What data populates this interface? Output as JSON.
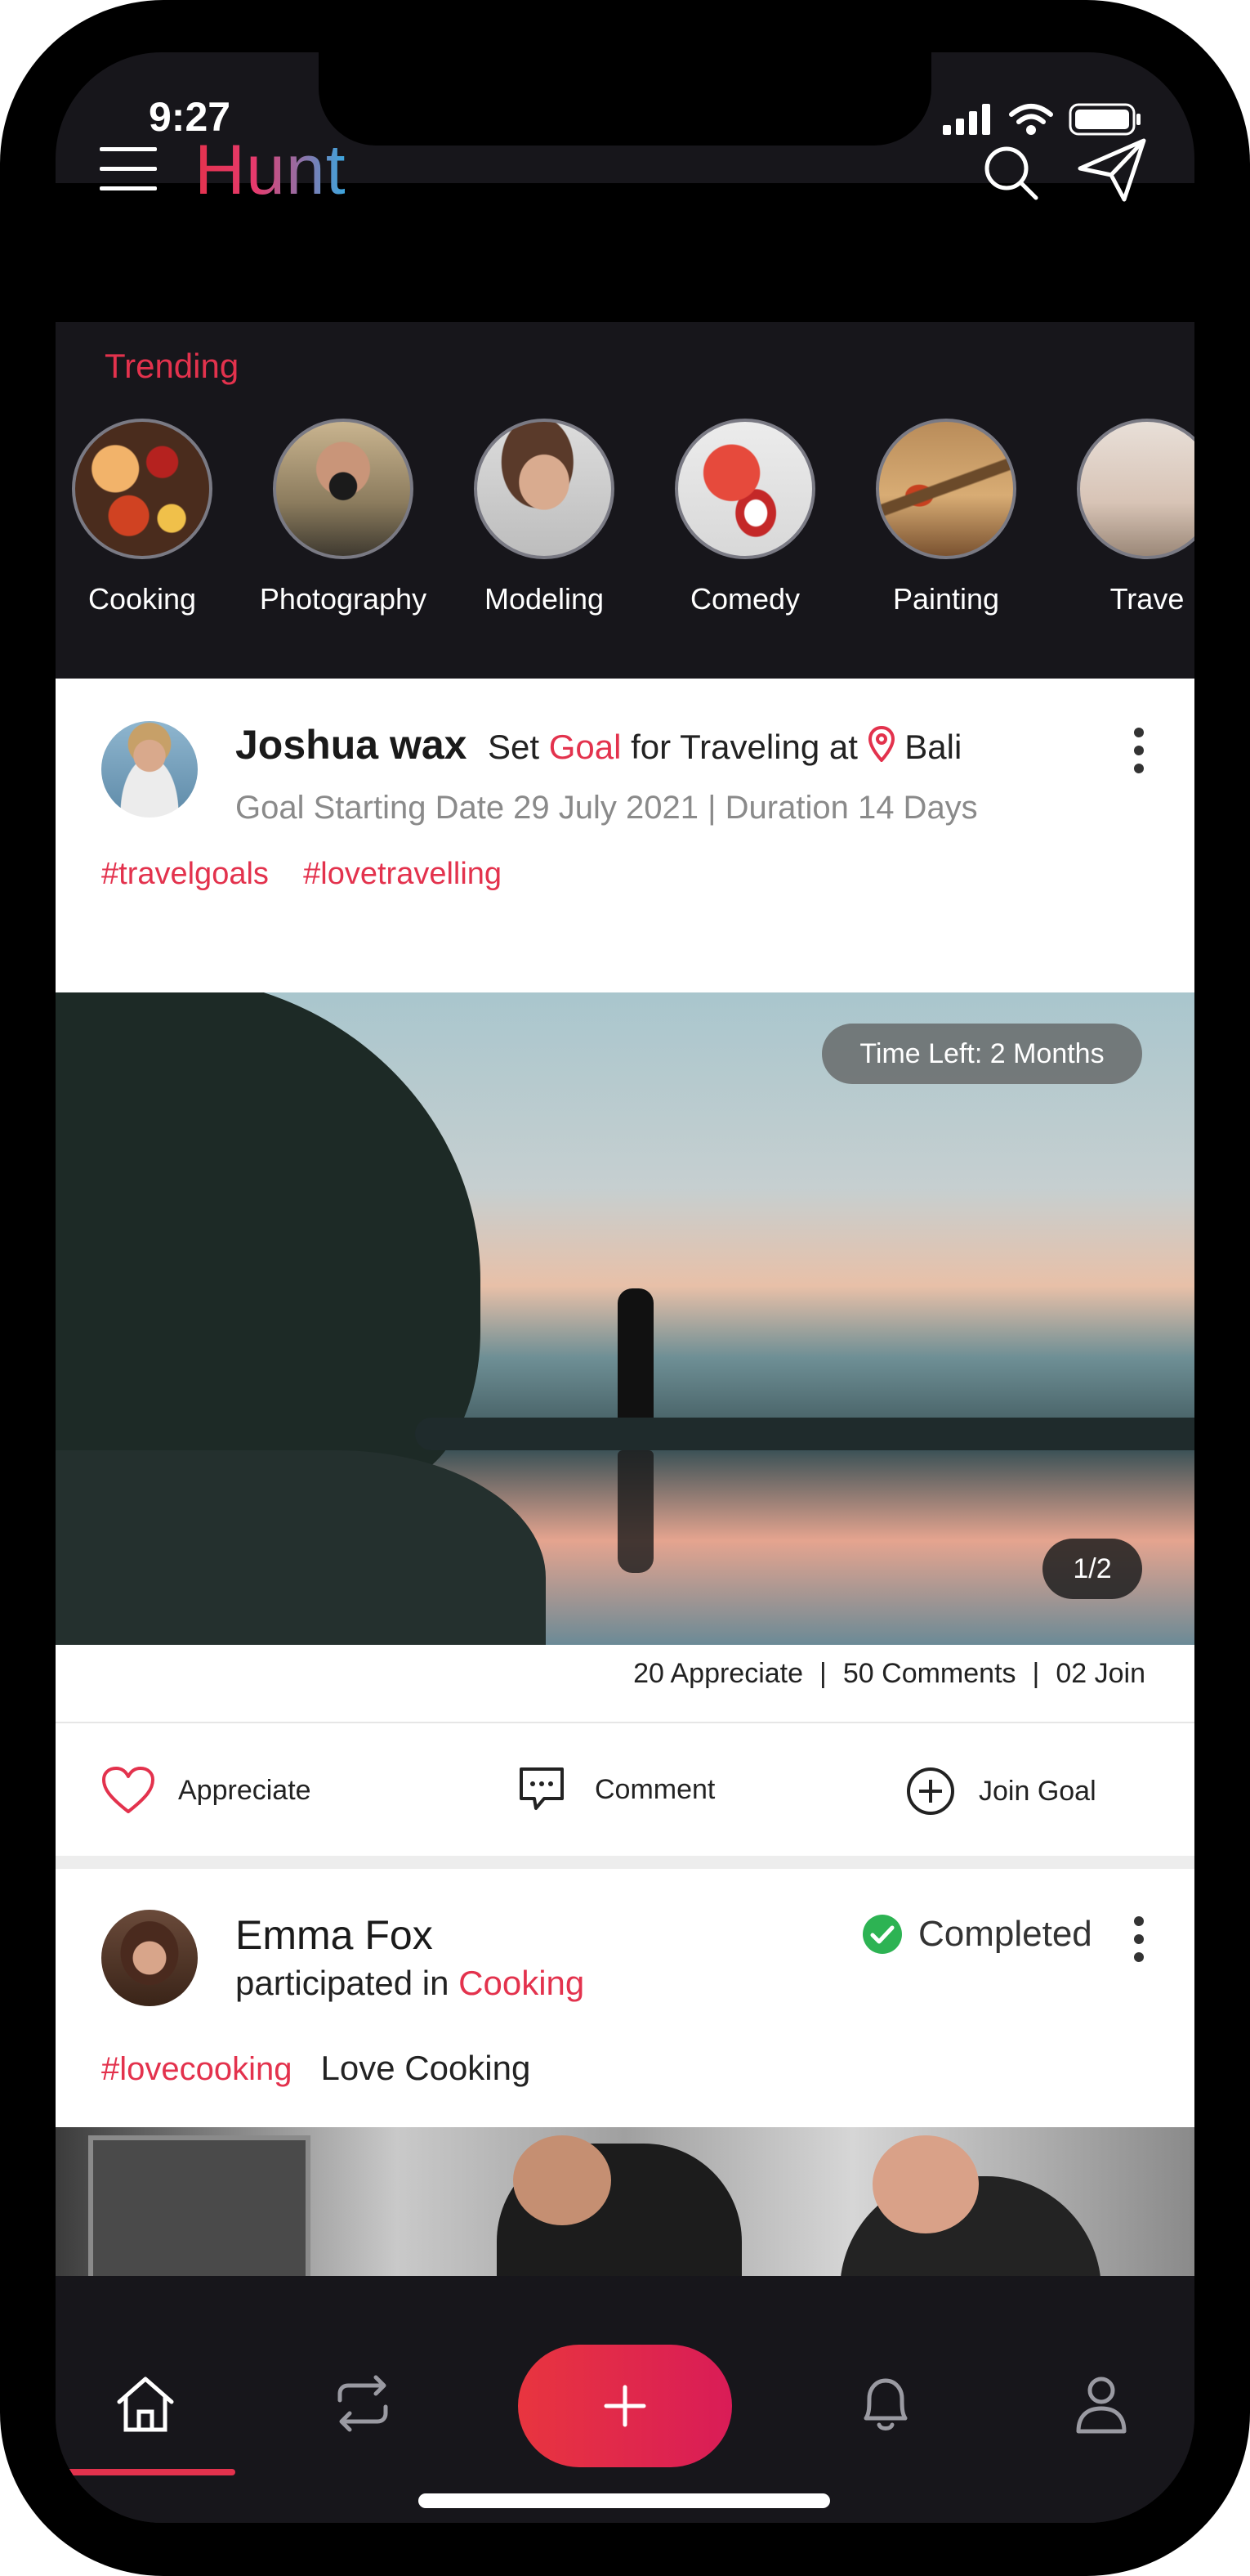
{
  "status_bar": {
    "time": "9:27"
  },
  "header": {
    "app_name": "Hunt"
  },
  "trending": {
    "title": "Trending",
    "items": [
      {
        "label": "Cooking"
      },
      {
        "label": "Photography"
      },
      {
        "label": "Modeling"
      },
      {
        "label": "Comedy"
      },
      {
        "label": "Painting"
      },
      {
        "label": "Trave"
      }
    ]
  },
  "post1": {
    "author": "Joshua wax",
    "action_prefix": "Set",
    "action_highlight": "Goal",
    "action_suffix": "for Traveling at",
    "location": "Bali",
    "goal_start": "Goal Starting Date 29 July 2021 |",
    "duration": "Duration 14 Days",
    "tags": [
      "#travelgoals",
      "#lovetravelling"
    ],
    "time_left": "Time Left: 2 Months",
    "image_counter": "1/2",
    "stats": {
      "appreciate": "20 Appreciate",
      "comments": "50 Comments",
      "join": "02 Join",
      "sep": "|"
    },
    "actions": {
      "appreciate": "Appreciate",
      "comment": "Comment",
      "join": "Join Goal"
    }
  },
  "post2": {
    "author": "Emma Fox",
    "participated_prefix": "participated in",
    "participated_topic": "Cooking",
    "status": "Completed",
    "tag": "#lovecooking",
    "caption": "Love Cooking"
  },
  "bottom_nav": {
    "items": [
      "home-icon",
      "repost-icon",
      "add-icon",
      "bell-icon",
      "profile-icon"
    ],
    "active": "home-icon"
  },
  "colors": {
    "accent": "#e3324d",
    "background": "#17161b",
    "status_green": "#2db353"
  }
}
